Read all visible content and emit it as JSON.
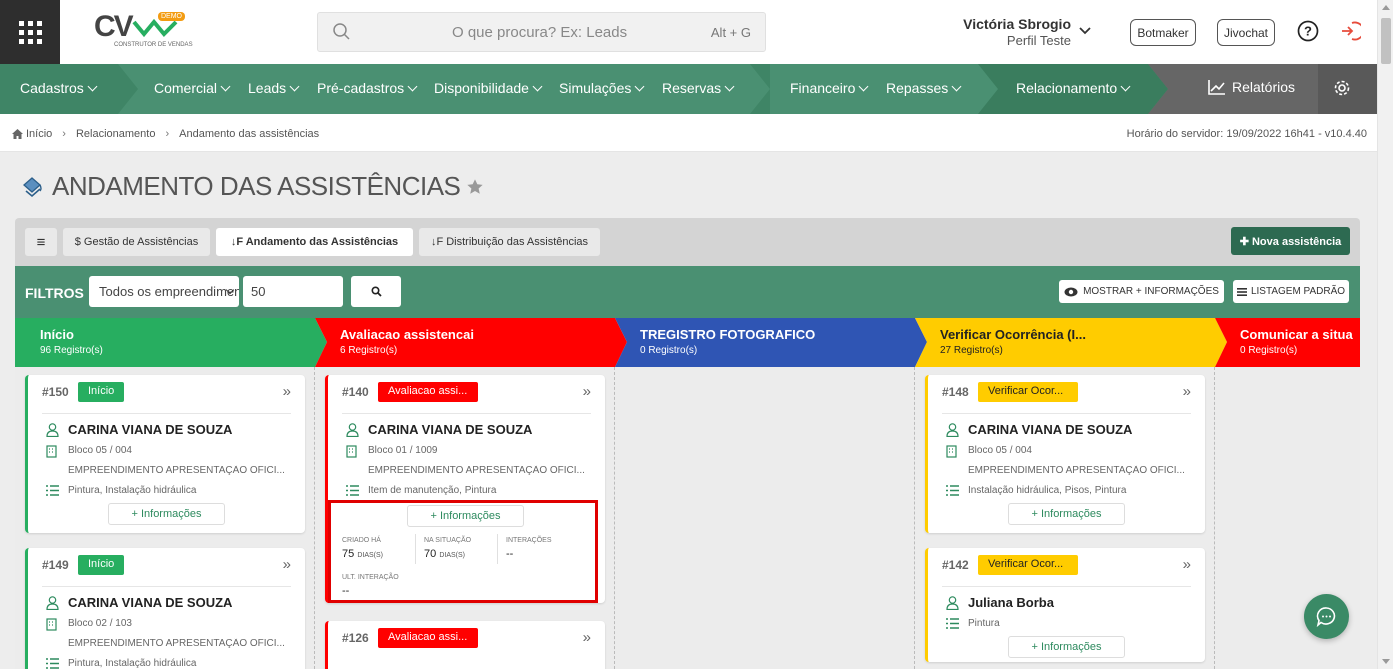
{
  "app": {
    "logo_text": "CV",
    "logo_badge": "DEMO",
    "logo_sub": "CONSTRUTOR DE VENDAS"
  },
  "search": {
    "placeholder": "O que procura? Ex: Leads",
    "shortcut": "Alt + G"
  },
  "user": {
    "name": "Victória Sbrogio",
    "profile": "Perfil Teste"
  },
  "header_buttons": {
    "botmaker": "Botmaker",
    "jivochat": "Jivochat"
  },
  "nav": {
    "items": [
      "Cadastros",
      "Comercial",
      "Leads",
      "Pré-cadastros",
      "Disponibilidade",
      "Simulações",
      "Reservas",
      "Financeiro",
      "Repasses",
      "Relacionamento"
    ],
    "reports": "Relatórios"
  },
  "breadcrumb": {
    "items": [
      "Início",
      "Relacionamento",
      "Andamento das assistências"
    ],
    "server_time": "Horário do servidor: 19/09/2022 16h41 - v10.4.40"
  },
  "page": {
    "title": "ANDAMENTO DAS ASSISTÊNCIAS"
  },
  "tabs": {
    "menu_glyph": "≡",
    "management": "$ Gestão de Assistências",
    "progress": "↓F Andamento das Assistências",
    "distribution": "↓F Distribuição das Assistências",
    "new": "✚ Nova assistência"
  },
  "filters": {
    "label": "FILTROS",
    "enterprise": "Todos os empreendimentos",
    "quantity": "50",
    "show_info": "MOSTRAR + INFORMAÇÕES",
    "default_list": "LISTAGEM PADRÃO"
  },
  "columns": [
    {
      "title": "Início",
      "count": "96 Registro(s)",
      "color": "#27ae60",
      "text": "#ffffff"
    },
    {
      "title": "Avaliacao assistencai",
      "count": "6 Registro(s)",
      "color": "#ff0000",
      "text": "#ffffff"
    },
    {
      "title": "TREGISTRO FOTOGRAFICO",
      "count": "0 Registro(s)",
      "color": "#2f55b4",
      "text": "#ffffff"
    },
    {
      "title": "Verificar Ocorrência (I...",
      "count": "27 Registro(s)",
      "color": "#ffcc00",
      "text": "#222222"
    },
    {
      "title": "Comunicar a situa",
      "count": "0 Registro(s)",
      "color": "#ff0000",
      "text": "#ffffff"
    }
  ],
  "cards": {
    "c150": {
      "num": "#150",
      "badge": "Início",
      "name": "CARINA VIANA DE SOUZA",
      "unit": "Bloco 05 / 004",
      "enterprise": "EMPREENDIMENTO APRESENTAÇÃO OFICI...",
      "items": "Pintura, Instalação hidráulica",
      "more": "+ Informações"
    },
    "c149": {
      "num": "#149",
      "badge": "Início",
      "name": "CARINA VIANA DE SOUZA",
      "unit": "Bloco 02 / 103",
      "enterprise": "EMPREENDIMENTO APRESENTAÇÃO OFICI...",
      "items": "Pintura, Instalação hidráulica"
    },
    "c140": {
      "num": "#140",
      "badge": "Avaliacao assi...",
      "name": "CARINA VIANA DE SOUZA",
      "unit": "Bloco 01 / 1009",
      "enterprise": "EMPREENDIMENTO APRESENTAÇÃO OFICI...",
      "items": "Item de manutenção, Pintura",
      "more": "+ Informações"
    },
    "c126": {
      "num": "#126",
      "badge": "Avaliacao assi..."
    },
    "c148": {
      "num": "#148",
      "badge": "Verificar Ocor...",
      "name": "CARINA VIANA DE SOUZA",
      "unit": "Bloco 05 / 004",
      "enterprise": "EMPREENDIMENTO APRESENTAÇÃO OFICI...",
      "items": "Instalação hidráulica, Pisos, Pintura",
      "more": "+ Informações"
    },
    "c142": {
      "num": "#142",
      "badge": "Verificar Ocor...",
      "name": "Juliana Borba",
      "items": "Pintura",
      "more": "+ Informações"
    }
  },
  "info": {
    "created_label": "CRIADO HÁ",
    "created_value": "75",
    "created_unit": "DIAS(S)",
    "status_label": "NA SITUAÇÃO",
    "status_value": "70",
    "status_unit": "DIAS(S)",
    "interactions_label": "INTERAÇÕES",
    "interactions_value": "--",
    "last_label": "ULT. INTERAÇÃO",
    "last_value": "--"
  }
}
